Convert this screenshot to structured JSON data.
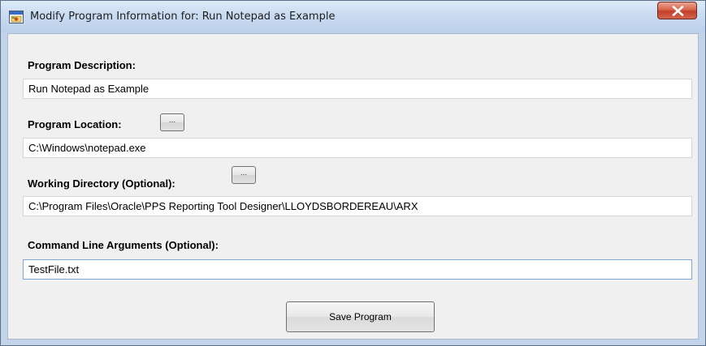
{
  "window": {
    "title": "Modify Program Information for: Run Notepad as Example",
    "app_icon": "program-window-icon",
    "close_icon": "close-icon"
  },
  "form": {
    "program_description": {
      "label": "Program Description:",
      "value": "Run Notepad as Example"
    },
    "program_location": {
      "label": "Program Location:",
      "browse_label": "...",
      "value": "C:\\Windows\\notepad.exe"
    },
    "working_directory": {
      "label": "Working Directory (Optional):",
      "browse_label": "...",
      "value": "C:\\Program Files\\Oracle\\PPS Reporting Tool Designer\\LLOYDSBORDEREAU\\ARX"
    },
    "command_line_arguments": {
      "label": "Command Line Arguments (Optional):",
      "value": "TestFile.txt"
    },
    "save_button": "Save Program"
  },
  "colors": {
    "title_bar": "#c9dbf1",
    "client_background": "#f0f0f0",
    "close_button": "#c2402a",
    "focused_field_border": "#7ea6d6"
  }
}
